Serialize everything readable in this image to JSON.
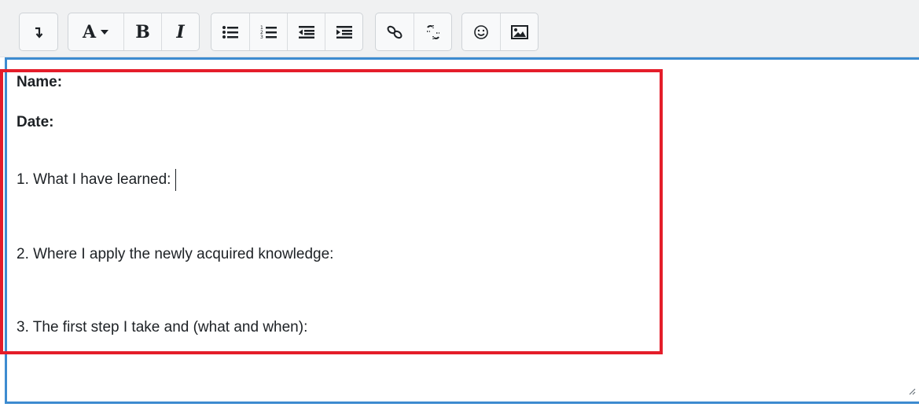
{
  "toolbar": {
    "groups": [
      {
        "name": "toggle",
        "buttons": [
          {
            "icon": "collapse-toolbar-icon"
          }
        ]
      },
      {
        "name": "format",
        "buttons": [
          {
            "icon": "paragraph-style-icon",
            "label": "A"
          },
          {
            "icon": "bold-icon",
            "label": "B"
          },
          {
            "icon": "italic-icon",
            "label": "I"
          }
        ]
      },
      {
        "name": "lists",
        "buttons": [
          {
            "icon": "unordered-list-icon"
          },
          {
            "icon": "ordered-list-icon"
          },
          {
            "icon": "outdent-icon"
          },
          {
            "icon": "indent-icon"
          }
        ]
      },
      {
        "name": "links",
        "buttons": [
          {
            "icon": "link-icon"
          },
          {
            "icon": "unlink-icon"
          }
        ]
      },
      {
        "name": "insert",
        "buttons": [
          {
            "icon": "emoticon-icon"
          },
          {
            "icon": "image-icon"
          }
        ]
      }
    ]
  },
  "editor": {
    "lines": {
      "name": "Name:",
      "date": "Date:",
      "q1": "1. What I have learned:",
      "q2": "2. Where I apply the newly acquired knowledge:",
      "q3": "3. The first step I take and (what and when):"
    }
  },
  "colors": {
    "editor_border": "#3d8bd0",
    "highlight_box": "#e41d2a",
    "toolbar_bg": "#f0f1f2"
  }
}
